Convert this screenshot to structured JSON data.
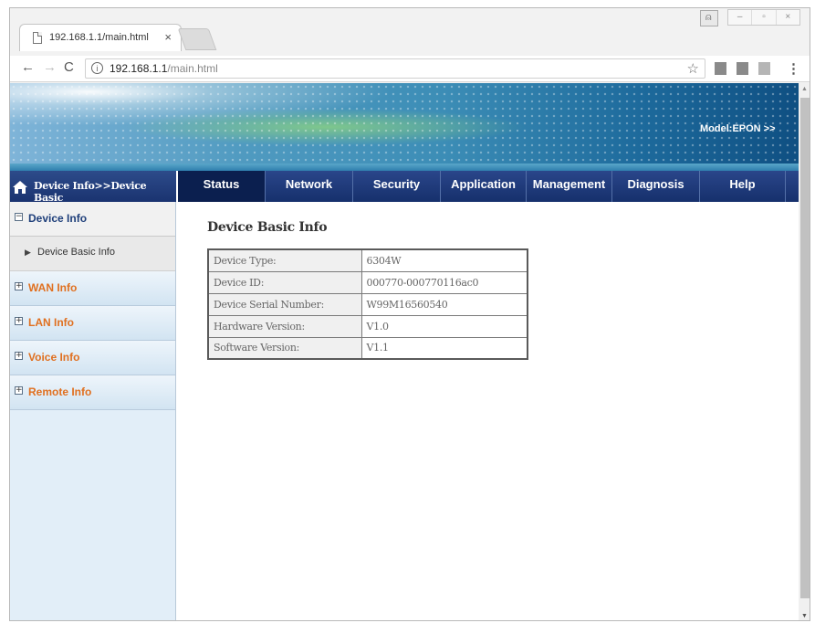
{
  "browser": {
    "tab_title": "192.168.1.1/main.html",
    "tab_close": "×",
    "url_host": "192.168.1.1",
    "url_path": "/main.html",
    "window_controls": [
      "–",
      "▫",
      "×"
    ]
  },
  "banner": {
    "model_label": "Model:EPON >>"
  },
  "breadcrumb": {
    "text": "Device Info>>Device Basic"
  },
  "nav": {
    "items": [
      "Status",
      "Network",
      "Security",
      "Application",
      "Management",
      "Diagnosis",
      "Help"
    ],
    "active": "Status"
  },
  "sidebar": {
    "device_info": "Device Info",
    "device_basic_info": "Device Basic Info",
    "wan_info": "WAN Info",
    "lan_info": "LAN Info",
    "voice_info": "Voice Info",
    "remote_info": "Remote Info"
  },
  "content": {
    "heading": "Device Basic Info",
    "rows": [
      {
        "label": "Device Type:",
        "value": "6304W"
      },
      {
        "label": "Device ID:",
        "value": "000770-000770116ac0"
      },
      {
        "label": "Device Serial Number:",
        "value": "W99M16560540"
      },
      {
        "label": "Hardware Version:",
        "value": "V1.0"
      },
      {
        "label": "Software Version:",
        "value": "V1.1"
      }
    ]
  },
  "colors": {
    "nav_bg": "#1f3a7a",
    "nav_active": "#0b1f4f",
    "sidebar_bg": "#e2eef8",
    "closed_group_text": "#e07020"
  }
}
